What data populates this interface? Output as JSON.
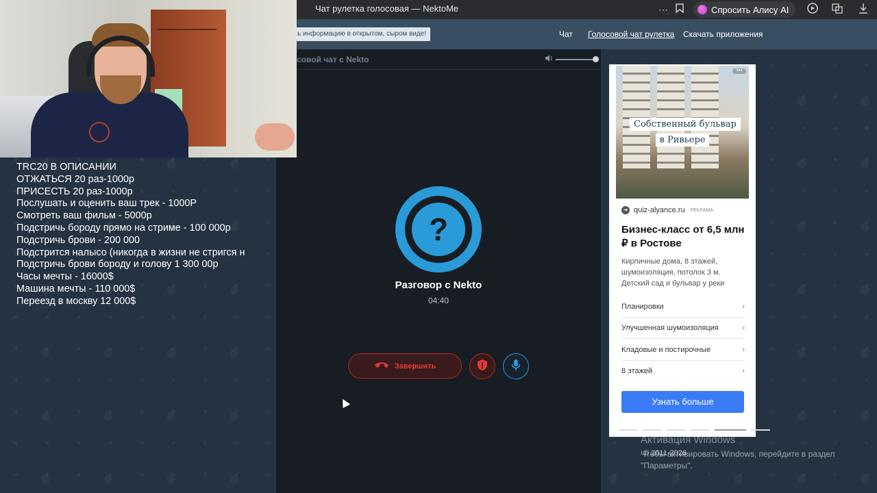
{
  "browser": {
    "page_title": "Чат рулетка голосовая — NektoMe",
    "alice_button": "Спросить Алису AI",
    "icons": [
      "more-icon",
      "bookmark-icon",
      "alice-icon",
      "play-icon",
      "translate-icon",
      "download-icon"
    ]
  },
  "site_header": {
    "notice": "ь информацию в открытом, сыром виде!",
    "nav": [
      {
        "label": "Чат",
        "active": false
      },
      {
        "label": "Голосовой чат рулетка",
        "active": true
      },
      {
        "label": "Скачать приложения",
        "active": false
      }
    ]
  },
  "chat": {
    "header_title": "совой чат с Nekto",
    "avatar_symbol": "?",
    "talk_title": "Разговор с Nekto",
    "timer": "04:40",
    "end_button": "Завершить"
  },
  "ad": {
    "image_caption_line1": "Собственный бульвар",
    "image_caption_line2": "в Ривьере",
    "domain": "quiz-alyance.ru",
    "ad_label": "РЕКЛАМА",
    "headline": "Бизнес-класс от 6,5 млн ₽ в Ростове",
    "description": "Кирпичные дома, 8 этажей, шумоизоляция, потолок 3 м. Детский сад и бульвар у реки",
    "links": [
      "Планировки",
      "Улучшенная шумоизоляция",
      "Кладовые и постирочные",
      "8 этажей"
    ],
    "cta": "Узнать больше"
  },
  "overlay": {
    "lines": [
      "TRC20 В ОПИСАНИИ",
      "ОТЖАТЬСЯ 20 раз-1000р",
      "ПРИСЕСТЬ 20 раз-1000р",
      "Послушать и оценить ваш трек - 1000Р",
      "Смотреть ваш фильм - 5000р",
      "Подстричь бороду прямо на стриме - 100 000р",
      "Подстричь брови - 200 000",
      "Подстрится налысо (никогда в жизни не стригся н",
      "Подстричь брови бороду и голову 1 300 00р",
      "Часы мечты - 16000$",
      "Машина мечты - 110 000$",
      "Переезд в москву 12 000$"
    ]
  },
  "footer": {
    "copyright": "© 2011-2026"
  },
  "windows_activation": {
    "title": "Активация Windows",
    "subtitle_line1": "Чтобы активировать Windows, перейдите в раздел",
    "subtitle_line2": "\"Параметры\"."
  },
  "colors": {
    "accent_blue": "#2a9bd8",
    "danger_red": "#e53935",
    "panel_bg": "#171d23",
    "header_bg": "#3a4e62",
    "ad_cta": "#3b7bf6"
  }
}
